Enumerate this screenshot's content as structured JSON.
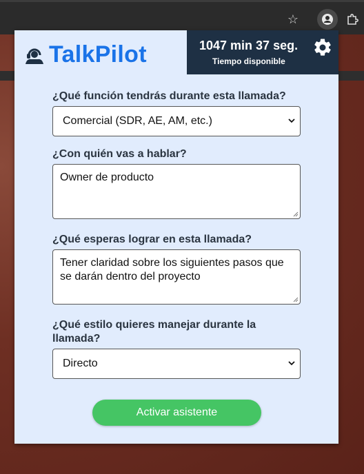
{
  "browser": {
    "icons": [
      "star-icon",
      "extension-icon",
      "puzzle-icon"
    ]
  },
  "header": {
    "brand": "TalkPilot",
    "time_value": "1047 min 37 seg.",
    "time_label": "Tiempo disponible",
    "brand_color": "#1a73e8",
    "timebox_color": "#1e3044"
  },
  "form": {
    "role": {
      "label": "¿Qué función tendrás durante esta llamada?",
      "value": "Comercial (SDR, AE, AM, etc.)"
    },
    "contact": {
      "label": "¿Con quién vas a hablar?",
      "value": "Owner de producto"
    },
    "goal": {
      "label": "¿Qué esperas lograr en esta llamada?",
      "value": "Tener claridad sobre los siguientes pasos que se darán dentro del proyecto"
    },
    "style": {
      "label": "¿Qué estilo quieres manejar durante la llamada?",
      "value": "Directo"
    }
  },
  "actions": {
    "activate_label": "Activar asistente",
    "activate_color": "#45c564"
  }
}
